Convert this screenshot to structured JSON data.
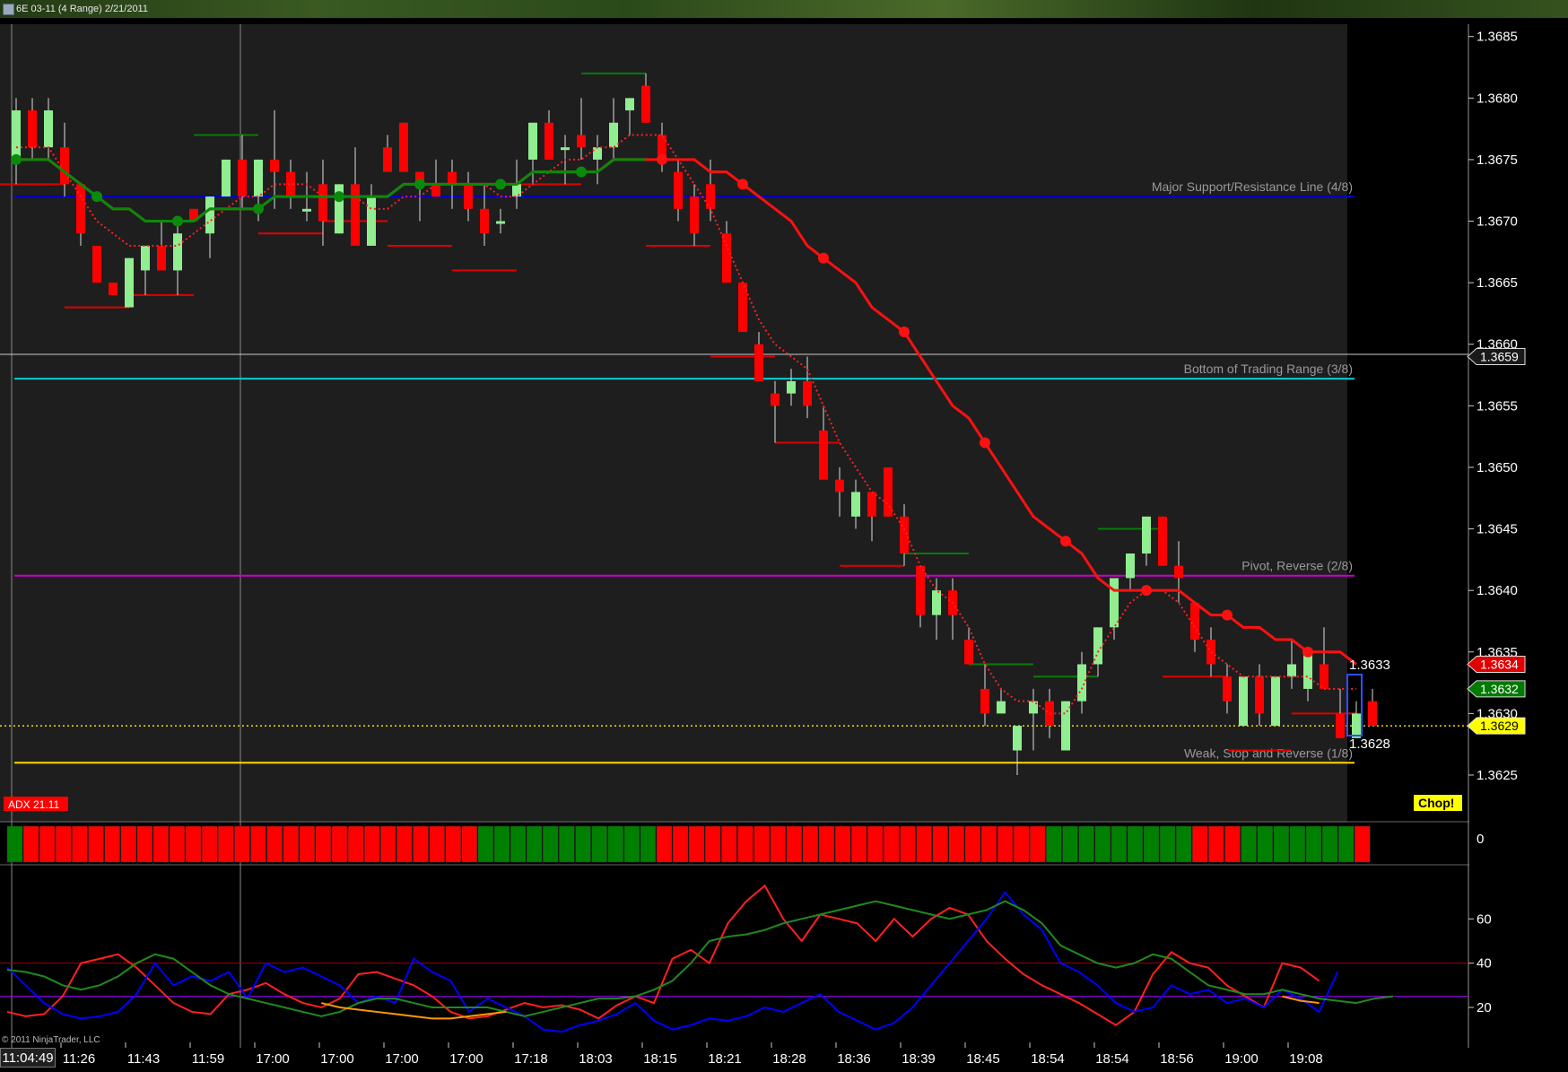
{
  "window": {
    "title": "6E 03-11 (4 Range)  2/21/2011"
  },
  "copyright": "© 2011 NinjaTrader, LLC",
  "clock": "11:04:49",
  "colors": {
    "bull": "#90EE90",
    "bear": "#FF0000",
    "ema_fast": "#FF0000",
    "ema_slow_up": "#008000",
    "dots": "#228B22"
  },
  "chart_data": [
    {
      "type": "candlestick",
      "title": "",
      "ylim": [
        1.36215,
        1.3686
      ],
      "y_ticks": [
        "1.3625",
        "1.3630",
        "1.3635",
        "1.3640",
        "1.3645",
        "1.3650",
        "1.3655",
        "1.3660",
        "1.3665",
        "1.3670",
        "1.3675",
        "1.3680",
        "1.3685"
      ],
      "x_labels": [
        "11:26",
        "11:43",
        "11:59",
        "17:00",
        "17:00",
        "17:00",
        "17:00",
        "17:18",
        "18:03",
        "18:15",
        "18:21",
        "18:28",
        "18:36",
        "18:39",
        "18:45",
        "18:54",
        "18:54",
        "18:56",
        "19:00",
        "19:08"
      ],
      "ohlc": [
        [
          1.3675,
          1.368,
          1.3673,
          1.3679
        ],
        [
          1.3679,
          1.368,
          1.3675,
          1.3676
        ],
        [
          1.3676,
          1.368,
          1.3675,
          1.3679
        ],
        [
          1.3676,
          1.3678,
          1.3672,
          1.3673
        ],
        [
          1.3673,
          1.3673,
          1.3668,
          1.3669
        ],
        [
          1.3668,
          1.3668,
          1.3665,
          1.3665
        ],
        [
          1.3665,
          1.3665,
          1.3664,
          1.3664
        ],
        [
          1.3663,
          1.3667,
          1.3663,
          1.3667
        ],
        [
          1.3666,
          1.3668,
          1.3664,
          1.3668
        ],
        [
          1.3668,
          1.367,
          1.3666,
          1.3666
        ],
        [
          1.3666,
          1.367,
          1.3664,
          1.3669
        ],
        [
          1.3671,
          1.3671,
          1.367,
          1.367
        ],
        [
          1.3669,
          1.3672,
          1.3667,
          1.3672
        ],
        [
          1.3672,
          1.3675,
          1.3672,
          1.3675
        ],
        [
          1.3675,
          1.3677,
          1.3671,
          1.3672
        ],
        [
          1.3672,
          1.3675,
          1.367,
          1.3675
        ],
        [
          1.3675,
          1.3679,
          1.3671,
          1.3674
        ],
        [
          1.3674,
          1.3675,
          1.3671,
          1.3672
        ],
        [
          1.3671,
          1.3674,
          1.367,
          1.3671
        ],
        [
          1.3673,
          1.3675,
          1.3668,
          1.367
        ],
        [
          1.3669,
          1.3673,
          1.3669,
          1.3673
        ],
        [
          1.3673,
          1.3676,
          1.3672,
          1.3668
        ],
        [
          1.3668,
          1.3673,
          1.3668,
          1.3672
        ],
        [
          1.3676,
          1.3677,
          1.3674,
          1.3674
        ],
        [
          1.3678,
          1.3678,
          1.3674,
          1.3674
        ],
        [
          1.3674,
          1.3674,
          1.367,
          1.3673
        ],
        [
          1.3673,
          1.3675,
          1.3672,
          1.3672
        ],
        [
          1.3674,
          1.3675,
          1.3671,
          1.3673
        ],
        [
          1.3673,
          1.3674,
          1.367,
          1.3671
        ],
        [
          1.3671,
          1.3673,
          1.3668,
          1.3669
        ],
        [
          1.367,
          1.3671,
          1.3669,
          1.367
        ],
        [
          1.3672,
          1.3675,
          1.3671,
          1.3673
        ],
        [
          1.3675,
          1.3678,
          1.3673,
          1.3678
        ],
        [
          1.3678,
          1.3679,
          1.3675,
          1.3675
        ],
        [
          1.3676,
          1.3677,
          1.3673,
          1.3676
        ],
        [
          1.3677,
          1.368,
          1.3675,
          1.3676
        ],
        [
          1.3675,
          1.3677,
          1.3673,
          1.3676
        ],
        [
          1.3676,
          1.368,
          1.3675,
          1.3678
        ],
        [
          1.3679,
          1.368,
          1.3677,
          1.368
        ],
        [
          1.3681,
          1.3682,
          1.3678,
          1.3678
        ],
        [
          1.3677,
          1.3678,
          1.3674,
          1.3675
        ],
        [
          1.3674,
          1.3675,
          1.367,
          1.3671
        ],
        [
          1.3672,
          1.3673,
          1.3668,
          1.3669
        ],
        [
          1.3673,
          1.3675,
          1.367,
          1.3671
        ],
        [
          1.3669,
          1.367,
          1.3665,
          1.3665
        ],
        [
          1.3665,
          1.3665,
          1.3661,
          1.3661
        ],
        [
          1.366,
          1.3661,
          1.3657,
          1.3657
        ],
        [
          1.3656,
          1.3657,
          1.3652,
          1.3655
        ],
        [
          1.3656,
          1.3658,
          1.3655,
          1.3657
        ],
        [
          1.3657,
          1.3659,
          1.3654,
          1.3655
        ],
        [
          1.3653,
          1.3655,
          1.365,
          1.3649
        ],
        [
          1.3649,
          1.365,
          1.3646,
          1.3648
        ],
        [
          1.3646,
          1.3649,
          1.3645,
          1.3648
        ],
        [
          1.3648,
          1.3648,
          1.3644,
          1.3646
        ],
        [
          1.365,
          1.365,
          1.3646,
          1.3646
        ],
        [
          1.3646,
          1.3647,
          1.3642,
          1.3643
        ],
        [
          1.3642,
          1.3642,
          1.3637,
          1.3638
        ],
        [
          1.3638,
          1.3641,
          1.3636,
          1.364
        ],
        [
          1.364,
          1.3641,
          1.3636,
          1.3638
        ],
        [
          1.3636,
          1.3637,
          1.3634,
          1.3634
        ],
        [
          1.3632,
          1.3634,
          1.3629,
          1.363
        ],
        [
          1.363,
          1.3632,
          1.363,
          1.3631
        ],
        [
          1.3627,
          1.3629,
          1.3625,
          1.3629
        ],
        [
          1.363,
          1.3632,
          1.3627,
          1.3631
        ],
        [
          1.3631,
          1.3632,
          1.3628,
          1.3629
        ],
        [
          1.3627,
          1.3631,
          1.3627,
          1.3631
        ],
        [
          1.3631,
          1.3635,
          1.363,
          1.3634
        ],
        [
          1.3634,
          1.3637,
          1.3633,
          1.3637
        ],
        [
          1.3637,
          1.364,
          1.3636,
          1.3641
        ],
        [
          1.3641,
          1.3643,
          1.364,
          1.3643
        ],
        [
          1.3643,
          1.3646,
          1.3642,
          1.3646
        ],
        [
          1.3646,
          1.3646,
          1.3642,
          1.3642
        ],
        [
          1.3642,
          1.3644,
          1.3639,
          1.3641
        ],
        [
          1.3639,
          1.3639,
          1.3635,
          1.3636
        ],
        [
          1.3636,
          1.3637,
          1.3633,
          1.3634
        ],
        [
          1.3633,
          1.3634,
          1.363,
          1.3631
        ],
        [
          1.3629,
          1.3633,
          1.3629,
          1.3633
        ],
        [
          1.3633,
          1.3634,
          1.3629,
          1.363
        ],
        [
          1.3629,
          1.3633,
          1.3629,
          1.3633
        ],
        [
          1.3633,
          1.3636,
          1.3632,
          1.3634
        ],
        [
          1.3632,
          1.3635,
          1.3631,
          1.3635
        ],
        [
          1.3634,
          1.3637,
          1.3632,
          1.3632
        ],
        [
          1.363,
          1.3632,
          1.3628,
          1.3628
        ],
        [
          1.3628,
          1.3631,
          1.3628,
          1.363
        ],
        [
          1.3631,
          1.3632,
          1.3629,
          1.3629
        ]
      ],
      "series": [
        {
          "values": [
            1.3675,
            1.3675,
            1.3675,
            1.3674,
            1.3673,
            1.3672,
            1.3671,
            1.3671,
            1.367,
            1.367,
            1.367,
            1.367,
            1.3671,
            1.3671,
            1.3671,
            1.3671,
            1.3672,
            1.3672,
            1.3672,
            1.3672,
            1.3672,
            1.3672,
            1.3672,
            1.3672,
            1.3673,
            1.3673,
            1.3673,
            1.3673,
            1.3673,
            1.3673,
            1.3673,
            1.3673,
            1.3674,
            1.3674,
            1.3674,
            1.3674,
            1.3674,
            1.3675,
            1.3675,
            1.3675,
            1.3675,
            1.3675,
            1.3675,
            1.3674,
            1.3674,
            1.3673,
            1.3672,
            1.3671,
            1.367,
            1.3668,
            1.3667,
            1.3666,
            1.3665,
            1.3663,
            1.3662,
            1.3661,
            1.3659,
            1.3657,
            1.3655,
            1.3654,
            1.3652,
            1.365,
            1.3648,
            1.3646,
            1.3645,
            1.3644,
            1.3643,
            1.3641,
            1.364,
            1.364,
            1.364,
            1.364,
            1.364,
            1.3639,
            1.3638,
            1.3638,
            1.3637,
            1.3637,
            1.3636,
            1.3636,
            1.3635,
            1.3635,
            1.3635,
            1.3634
          ]
        },
        {
          "values": [
            1.3676,
            1.3676,
            1.3676,
            1.3674,
            1.3672,
            1.367,
            1.3669,
            1.3668,
            1.3668,
            1.3668,
            1.3668,
            1.3669,
            1.367,
            1.3671,
            1.3672,
            1.3672,
            1.3673,
            1.3673,
            1.3673,
            1.3672,
            1.3672,
            1.3672,
            1.3671,
            1.3671,
            1.3672,
            1.3672,
            1.3673,
            1.3673,
            1.3673,
            1.3673,
            1.3672,
            1.3672,
            1.3673,
            1.3674,
            1.3675,
            1.3675,
            1.3676,
            1.3676,
            1.3677,
            1.3677,
            1.3677,
            1.3675,
            1.3673,
            1.3671,
            1.3668,
            1.3665,
            1.3662,
            1.366,
            1.3659,
            1.3658,
            1.3655,
            1.3652,
            1.365,
            1.3648,
            1.3647,
            1.3645,
            1.3642,
            1.364,
            1.3639,
            1.3637,
            1.3634,
            1.3632,
            1.3631,
            1.3631,
            1.363,
            1.363,
            1.3632,
            1.3635,
            1.3637,
            1.3639,
            1.364,
            1.364,
            1.3639,
            1.3637,
            1.3635,
            1.3634,
            1.3633,
            1.3633,
            1.3633,
            1.3633,
            1.3633,
            1.3632,
            1.3632,
            1.3632
          ]
        }
      ],
      "trend_markers": [
        0.0,
        5.0,
        10.0,
        15.0,
        20.0,
        25.0,
        30.0,
        35.0,
        40.0,
        45.0,
        50.0,
        55.0,
        60.0,
        65.0,
        70.0,
        75.0,
        80.0
      ],
      "horizontal_lines": [
        {
          "value": 1.3672,
          "color": "#0000CD",
          "label": "Major Support/Resistance Line (4/8)"
        },
        {
          "value": 1.36572,
          "color": "#00CED1",
          "label": "Bottom of Trading Range (3/8)"
        },
        {
          "value": 1.36412,
          "color": "#CC00CC",
          "label": "Pivot, Reverse (2/8)"
        },
        {
          "value": 1.3626,
          "color": "#FFD700",
          "label": "Weak, Stop and Reverse (1/8)"
        }
      ],
      "price_boxes": [
        {
          "value": "1.3659",
          "bg": "#1a1a1a",
          "fg": "#ffffff",
          "at": 1.3659
        },
        {
          "value": "1.3634",
          "bg": "#e00000",
          "fg": "#ffffff",
          "at": 1.3634
        },
        {
          "value": "1.3632",
          "bg": "#007a00",
          "fg": "#ffffff",
          "at": 1.3632
        },
        {
          "value": "1.3629",
          "bg": "#ffff00",
          "fg": "#000000",
          "at": 1.3629
        }
      ],
      "range_labels": {
        "high": "1.3633",
        "low": "1.3628"
      },
      "adx_label": "ADX 21.11",
      "chop_label": "Chop!"
    },
    {
      "type": "bar",
      "title": "",
      "y_ticks": [
        "0"
      ],
      "colors_sequence": "g r r r r r r r r r r r r r r r r r r r r r r r r r r r r g g g g g g g g g g g r r r r r r r r r r r r r r r r r r r r r r r r g g g g g g g g g r r r g g g g g g g r"
    },
    {
      "type": "line",
      "title": "",
      "ylim": [
        5,
        80
      ],
      "y_ticks": [
        "20",
        "40",
        "60"
      ],
      "ref_lines": [
        40,
        25
      ],
      "series": [
        {
          "color": "#ff2020",
          "values": [
            18,
            16,
            17,
            25,
            40,
            42,
            44,
            38,
            30,
            22,
            18,
            17,
            26,
            28,
            31,
            26,
            22,
            20,
            24,
            35,
            36,
            33,
            30,
            25,
            18,
            15,
            16,
            19,
            22,
            20,
            21,
            19,
            15,
            21,
            25,
            22,
            42,
            46,
            40,
            58,
            68,
            75,
            60,
            50,
            62,
            60,
            58,
            50,
            60,
            52,
            60,
            65,
            62,
            50,
            42,
            35,
            30,
            26,
            22,
            17,
            12,
            18,
            35,
            45,
            40,
            38,
            30,
            25,
            20,
            40,
            38,
            32
          ]
        },
        {
          "color": "#0000ff",
          "values": [
            38,
            30,
            22,
            17,
            15,
            16,
            18,
            26,
            40,
            30,
            34,
            32,
            36,
            24,
            40,
            36,
            38,
            34,
            30,
            22,
            25,
            22,
            42,
            36,
            32,
            18,
            24,
            20,
            16,
            10,
            9,
            12,
            14,
            17,
            22,
            14,
            10,
            12,
            15,
            14,
            16,
            20,
            18,
            22,
            26,
            18,
            14,
            10,
            13,
            20,
            30,
            40,
            50,
            60,
            72,
            62,
            55,
            40,
            36,
            30,
            22,
            18,
            20,
            30,
            26,
            28,
            22,
            24,
            20,
            28,
            24,
            18,
            36
          ]
        },
        {
          "color": "#1f8a1f",
          "values": [
            37,
            36,
            34,
            30,
            28,
            30,
            34,
            40,
            44,
            42,
            36,
            30,
            26,
            24,
            22,
            20,
            18,
            16,
            18,
            22,
            24,
            24,
            22,
            20,
            20,
            20,
            20,
            18,
            16,
            18,
            20,
            22,
            24,
            24,
            25,
            28,
            32,
            40,
            50,
            52,
            53,
            55,
            58,
            60,
            62,
            64,
            66,
            68,
            66,
            64,
            62,
            60,
            62,
            64,
            68,
            64,
            58,
            48,
            44,
            40,
            38,
            40,
            44,
            42,
            36,
            30,
            28,
            26,
            26,
            28,
            26,
            24,
            23,
            22,
            24,
            25
          ]
        },
        {
          "color": "#ff9900",
          "values": [
            null,
            null,
            null,
            null,
            null,
            null,
            null,
            null,
            null,
            null,
            null,
            null,
            null,
            null,
            null,
            null,
            null,
            22,
            20,
            19,
            18,
            17,
            16,
            15,
            15,
            16,
            17,
            18,
            null,
            null,
            null,
            null,
            null,
            null,
            null,
            null,
            null,
            null,
            null,
            null,
            null,
            null,
            null,
            null,
            null,
            null,
            null,
            null,
            null,
            null,
            null,
            null,
            null,
            null,
            null,
            null,
            null,
            null,
            null,
            null,
            null,
            null,
            null,
            null,
            null,
            null,
            null,
            null,
            null,
            25,
            23,
            22
          ]
        }
      ]
    }
  ]
}
